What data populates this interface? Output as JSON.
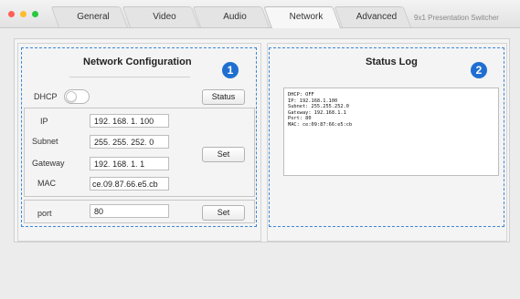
{
  "window": {
    "tabs": [
      {
        "label": "General",
        "active": false
      },
      {
        "label": "Video",
        "active": false
      },
      {
        "label": "Audio",
        "active": false
      },
      {
        "label": "Network",
        "active": true
      },
      {
        "label": "Advanced",
        "active": false
      }
    ],
    "app_title": "9x1 Presentation Switcher"
  },
  "network": {
    "heading": "Network Configuration",
    "badge": "1",
    "dhcp_label": "DHCP",
    "dhcp_on": false,
    "status_button": "Status",
    "ip_label": "IP",
    "ip": [
      "192",
      "168",
      "1",
      "100"
    ],
    "subnet_label": "Subnet",
    "subnet": [
      "255",
      "255",
      "252",
      "0"
    ],
    "gateway_label": "Gateway",
    "gateway": [
      "192",
      "168",
      "1",
      "1"
    ],
    "mac_label": "MAC",
    "mac": [
      "ce",
      "09",
      "87",
      "66",
      "e5",
      "cb"
    ],
    "set_button": "Set",
    "port_label": "port",
    "port": "80",
    "port_set_button": "Set"
  },
  "status": {
    "heading": "Status Log",
    "badge": "2",
    "lines": [
      "DHCP: OFF",
      "IP: 192.168.1.100",
      "Subnet: 255.255.252.0",
      "Gateway: 192.168.1.1",
      "Port: 80",
      "MAC: ce:09:87:66:e5:cb"
    ]
  },
  "colors": {
    "accent": "#1f6fd1",
    "dashed_border": "#3b88d8",
    "close": "#ff5f57",
    "minimize": "#febc2e",
    "zoom": "#28c840"
  }
}
